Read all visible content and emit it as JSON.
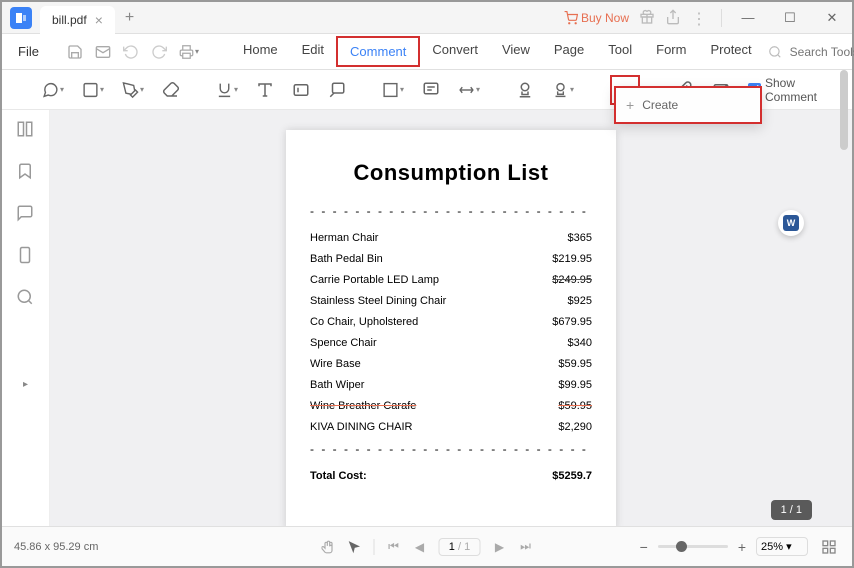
{
  "titlebar": {
    "filename": "bill.pdf",
    "buy_now": "Buy Now"
  },
  "menubar": {
    "file": "File",
    "tabs": [
      "Home",
      "Edit",
      "Comment",
      "Convert",
      "View",
      "Page",
      "Tool",
      "Form",
      "Protect"
    ],
    "search_placeholder": "Search Tools"
  },
  "toolbar": {
    "show_comment": "Show Comment"
  },
  "create_popup": {
    "label": "Create"
  },
  "document": {
    "title": "Consumption List",
    "items": [
      {
        "name": "Herman Chair",
        "price": "$365"
      },
      {
        "name": "Bath Pedal Bin",
        "price": "$219.95"
      },
      {
        "name": "Carrie Portable LED Lamp",
        "price": "$249.95"
      },
      {
        "name": "Stainless Steel Dining Chair",
        "price": "$925"
      },
      {
        "name": "Co Chair, Upholstered",
        "price": "$679.95"
      },
      {
        "name": "Spence Chair",
        "price": "$340"
      },
      {
        "name": "Wire Base",
        "price": "$59.95"
      },
      {
        "name": "Bath Wiper",
        "price": "$99.95"
      },
      {
        "name": "Wine Breather Carafe",
        "price": "$59.95"
      },
      {
        "name": "KIVA DINING CHAIR",
        "price": "$2,290"
      }
    ],
    "total_label": "Total Cost:",
    "total_value": "$5259.7"
  },
  "status": {
    "coords": "45.86 x 95.29 cm",
    "page_current": "1",
    "page_total": "/ 1",
    "zoom": "25%",
    "page_indicator": "1 / 1"
  }
}
